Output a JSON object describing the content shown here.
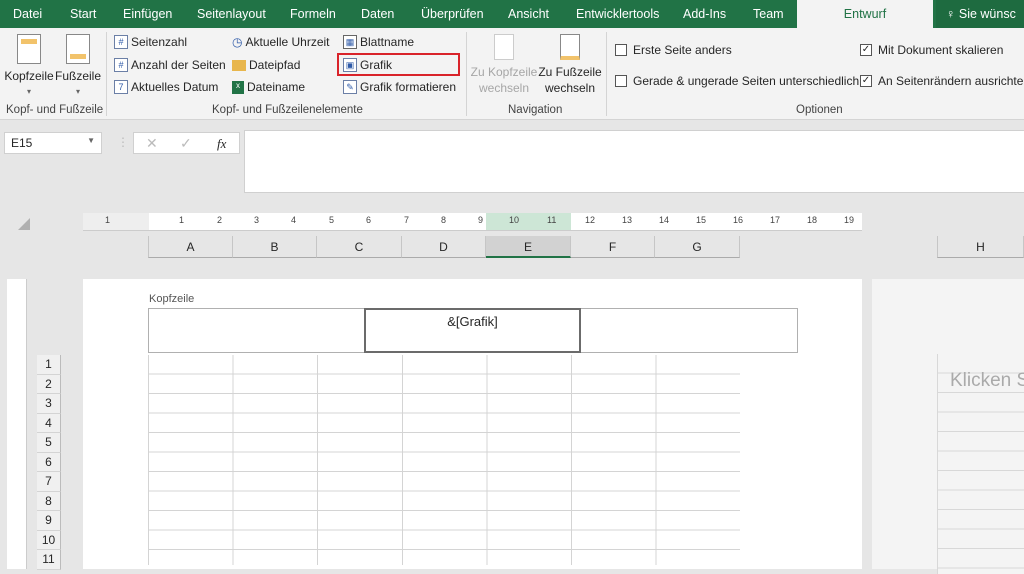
{
  "tabs": [
    "Datei",
    "Start",
    "Einfügen",
    "Seitenlayout",
    "Formeln",
    "Daten",
    "Überprüfen",
    "Ansicht",
    "Entwicklertools",
    "Add-Ins",
    "Team",
    "Entwurf"
  ],
  "tell_me": "Sie wünsc",
  "ribbon": {
    "kopf_fuss": {
      "kopfzeile": "Kopfzeile",
      "fusszeile": "Fußzeile",
      "label": "Kopf- und Fußzeile"
    },
    "elemente": {
      "items": [
        "Seitenzahl",
        "Anzahl der Seiten",
        "Aktuelles Datum",
        "Aktuelle Uhrzeit",
        "Dateipfad",
        "Dateiname",
        "Blattname",
        "Grafik",
        "Grafik formatieren"
      ],
      "label": "Kopf- und Fußzeilenelemente"
    },
    "navigation": {
      "zu_kopf": "Zu Kopfzeile wechseln",
      "zu_fuss": "Zu Fußzeile wechseln",
      "label": "Navigation"
    },
    "optionen": {
      "items": [
        {
          "label": "Erste Seite anders",
          "checked": false
        },
        {
          "label": "Gerade & ungerade Seiten unterschiedlich",
          "checked": false
        },
        {
          "label": "Mit Dokument skalieren",
          "checked": true
        },
        {
          "label": "An Seitenrändern ausrichten",
          "checked": true
        }
      ],
      "label": "Optionen"
    }
  },
  "formula_bar": {
    "name_box": "E15",
    "fx": "fx",
    "cancel": "✕",
    "enter": "✓",
    "value": ""
  },
  "ruler": [
    "1",
    "1",
    "2",
    "3",
    "4",
    "5",
    "6",
    "7",
    "8",
    "9",
    "10",
    "11",
    "12",
    "13",
    "14",
    "15",
    "16",
    "17",
    "18",
    "19"
  ],
  "columns": [
    "A",
    "B",
    "C",
    "D",
    "E",
    "F",
    "G",
    "H"
  ],
  "header": {
    "label": "Kopfzeile",
    "center": "&[Grafik]"
  },
  "rows": [
    "1",
    "2",
    "3",
    "4",
    "5",
    "6",
    "7",
    "8",
    "9",
    "10",
    "11"
  ],
  "page2_text": "Klicken S"
}
